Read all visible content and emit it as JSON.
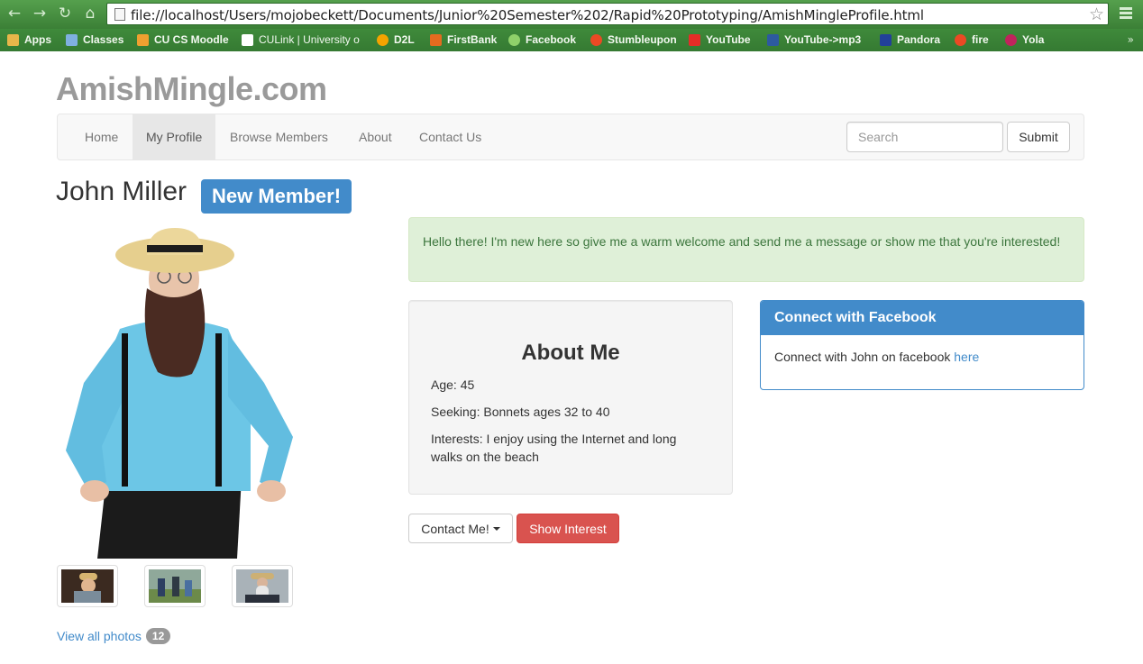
{
  "browser": {
    "url": "file://localhost/Users/mojobeckett/Documents/Junior%20Semester%202/Rapid%20Prototyping/AmishMingleProfile.html",
    "bookmarks": [
      {
        "label": "Apps",
        "color": "#e8b64a"
      },
      {
        "label": "Classes",
        "color": "#7fb0e0"
      },
      {
        "label": "CU CS Moodle",
        "color": "#f0a030"
      },
      {
        "label": "CULink | University o",
        "color": "#ffffff"
      },
      {
        "label": "D2L",
        "color": "#f4a300"
      },
      {
        "label": "FirstBank",
        "color": "#e46b1f"
      },
      {
        "label": "Facebook",
        "color": "#8fd16a"
      },
      {
        "label": "Stumbleupon",
        "color": "#eb4924"
      },
      {
        "label": "YouTube",
        "color": "#e52d27"
      },
      {
        "label": "YouTube->mp3",
        "color": "#2d5aa0"
      },
      {
        "label": "Pandora",
        "color": "#224099"
      },
      {
        "label": "fire",
        "color": "#eb4924"
      },
      {
        "label": "Yola",
        "color": "#c0245c"
      }
    ],
    "more": "»"
  },
  "site": {
    "brand": "AmishMingle.com",
    "nav": [
      {
        "label": "Home"
      },
      {
        "label": "My Profile"
      },
      {
        "label": "Browse Members"
      },
      {
        "label": "About"
      },
      {
        "label": "Contact Us"
      }
    ],
    "search_placeholder": "Search",
    "submit_label": "Submit"
  },
  "profile": {
    "name": "John Miller",
    "badge": "New Member!",
    "alert": "Hello there! I'm new here so give me a warm welcome and send me a message or show me that you're interested!",
    "about_title": "About Me",
    "age": "Age: 45",
    "seeking": "Seeking: Bonnets ages 32 to 40",
    "interests": "Interests: I enjoy using the Internet and long walks on the beach",
    "view_photos": "View all photos",
    "photo_count": "12",
    "contact_label": "Contact Me!",
    "interest_label": "Show Interest"
  },
  "facebook": {
    "heading": "Connect with Facebook",
    "text": "Connect with John on facebook",
    "link": "here"
  },
  "colors": {
    "primary": "#428bca",
    "danger": "#d9534f",
    "success_bg": "#dff0d8",
    "success_text": "#3c763d",
    "chrome_green": "#3b8036"
  }
}
